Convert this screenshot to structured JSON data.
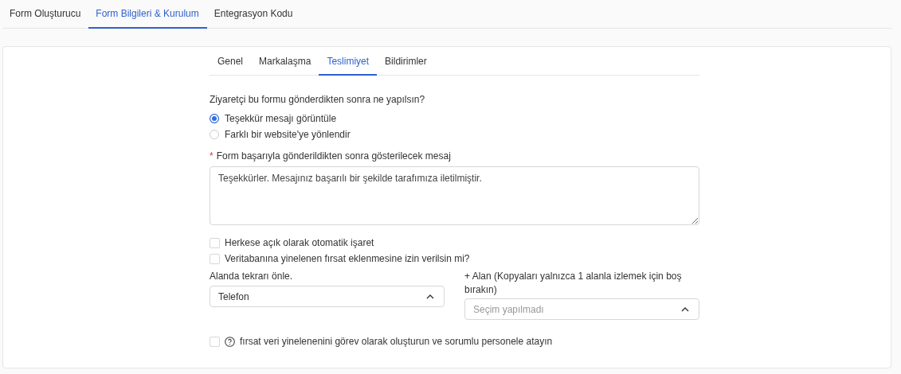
{
  "main_tabs": [
    {
      "label": "Form Oluşturucu",
      "selected": false
    },
    {
      "label": "Form Bilgileri & Kurulum",
      "selected": true
    },
    {
      "label": "Entegrasyon Kodu",
      "selected": false
    }
  ],
  "sub_tabs": [
    {
      "label": "Genel",
      "selected": false
    },
    {
      "label": "Markalaşma",
      "selected": false
    },
    {
      "label": "Teslimiyet",
      "selected": true
    },
    {
      "label": "Bildirimler",
      "selected": false
    }
  ],
  "question": "Ziyaretçi bu formu gönderdikten sonra ne yapılsın?",
  "options": [
    {
      "label": "Teşekkür mesajı görüntüle",
      "selected": true
    },
    {
      "label": "Farklı bir website'ye yönlendir",
      "selected": false
    }
  ],
  "message": {
    "required_mark": "*",
    "label": "Form başarıyla gönderildikten sonra gösterilecek mesaj",
    "value": "Teşekkürler. Mesajınız başarılı bir şekilde tarafımıza iletilmiştir."
  },
  "checkboxes": [
    {
      "label": "Herkese açık olarak otomatik işaret",
      "checked": false
    },
    {
      "label": "Veritabanına yinelenen fırsat eklenmesine izin verilsin mi?",
      "checked": false
    }
  ],
  "duplicate_field": {
    "label": "Alanda tekrarı önle.",
    "value": "Telefon"
  },
  "extra_field": {
    "label": "+ Alan (Kopyaları yalnızca 1 alanla izlemek için boş bırakın)",
    "placeholder": "Seçim yapılmadı"
  },
  "task_option": {
    "label": "fırsat veri yinelenenini görev olarak oluşturun ve sorumlu personele atayın",
    "checked": false
  }
}
